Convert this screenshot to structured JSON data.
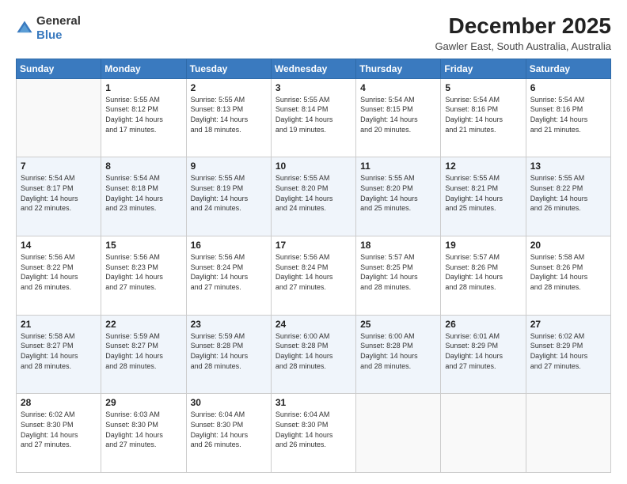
{
  "header": {
    "logo_general": "General",
    "logo_blue": "Blue",
    "title": "December 2025",
    "subtitle": "Gawler East, South Australia, Australia"
  },
  "calendar": {
    "days_of_week": [
      "Sunday",
      "Monday",
      "Tuesday",
      "Wednesday",
      "Thursday",
      "Friday",
      "Saturday"
    ],
    "weeks": [
      [
        {
          "day": "",
          "info": ""
        },
        {
          "day": "1",
          "info": "Sunrise: 5:55 AM\nSunset: 8:12 PM\nDaylight: 14 hours\nand 17 minutes."
        },
        {
          "day": "2",
          "info": "Sunrise: 5:55 AM\nSunset: 8:13 PM\nDaylight: 14 hours\nand 18 minutes."
        },
        {
          "day": "3",
          "info": "Sunrise: 5:55 AM\nSunset: 8:14 PM\nDaylight: 14 hours\nand 19 minutes."
        },
        {
          "day": "4",
          "info": "Sunrise: 5:54 AM\nSunset: 8:15 PM\nDaylight: 14 hours\nand 20 minutes."
        },
        {
          "day": "5",
          "info": "Sunrise: 5:54 AM\nSunset: 8:16 PM\nDaylight: 14 hours\nand 21 minutes."
        },
        {
          "day": "6",
          "info": "Sunrise: 5:54 AM\nSunset: 8:16 PM\nDaylight: 14 hours\nand 21 minutes."
        }
      ],
      [
        {
          "day": "7",
          "info": "Sunrise: 5:54 AM\nSunset: 8:17 PM\nDaylight: 14 hours\nand 22 minutes."
        },
        {
          "day": "8",
          "info": "Sunrise: 5:54 AM\nSunset: 8:18 PM\nDaylight: 14 hours\nand 23 minutes."
        },
        {
          "day": "9",
          "info": "Sunrise: 5:55 AM\nSunset: 8:19 PM\nDaylight: 14 hours\nand 24 minutes."
        },
        {
          "day": "10",
          "info": "Sunrise: 5:55 AM\nSunset: 8:20 PM\nDaylight: 14 hours\nand 24 minutes."
        },
        {
          "day": "11",
          "info": "Sunrise: 5:55 AM\nSunset: 8:20 PM\nDaylight: 14 hours\nand 25 minutes."
        },
        {
          "day": "12",
          "info": "Sunrise: 5:55 AM\nSunset: 8:21 PM\nDaylight: 14 hours\nand 25 minutes."
        },
        {
          "day": "13",
          "info": "Sunrise: 5:55 AM\nSunset: 8:22 PM\nDaylight: 14 hours\nand 26 minutes."
        }
      ],
      [
        {
          "day": "14",
          "info": "Sunrise: 5:56 AM\nSunset: 8:22 PM\nDaylight: 14 hours\nand 26 minutes."
        },
        {
          "day": "15",
          "info": "Sunrise: 5:56 AM\nSunset: 8:23 PM\nDaylight: 14 hours\nand 27 minutes."
        },
        {
          "day": "16",
          "info": "Sunrise: 5:56 AM\nSunset: 8:24 PM\nDaylight: 14 hours\nand 27 minutes."
        },
        {
          "day": "17",
          "info": "Sunrise: 5:56 AM\nSunset: 8:24 PM\nDaylight: 14 hours\nand 27 minutes."
        },
        {
          "day": "18",
          "info": "Sunrise: 5:57 AM\nSunset: 8:25 PM\nDaylight: 14 hours\nand 28 minutes."
        },
        {
          "day": "19",
          "info": "Sunrise: 5:57 AM\nSunset: 8:26 PM\nDaylight: 14 hours\nand 28 minutes."
        },
        {
          "day": "20",
          "info": "Sunrise: 5:58 AM\nSunset: 8:26 PM\nDaylight: 14 hours\nand 28 minutes."
        }
      ],
      [
        {
          "day": "21",
          "info": "Sunrise: 5:58 AM\nSunset: 8:27 PM\nDaylight: 14 hours\nand 28 minutes."
        },
        {
          "day": "22",
          "info": "Sunrise: 5:59 AM\nSunset: 8:27 PM\nDaylight: 14 hours\nand 28 minutes."
        },
        {
          "day": "23",
          "info": "Sunrise: 5:59 AM\nSunset: 8:28 PM\nDaylight: 14 hours\nand 28 minutes."
        },
        {
          "day": "24",
          "info": "Sunrise: 6:00 AM\nSunset: 8:28 PM\nDaylight: 14 hours\nand 28 minutes."
        },
        {
          "day": "25",
          "info": "Sunrise: 6:00 AM\nSunset: 8:28 PM\nDaylight: 14 hours\nand 28 minutes."
        },
        {
          "day": "26",
          "info": "Sunrise: 6:01 AM\nSunset: 8:29 PM\nDaylight: 14 hours\nand 27 minutes."
        },
        {
          "day": "27",
          "info": "Sunrise: 6:02 AM\nSunset: 8:29 PM\nDaylight: 14 hours\nand 27 minutes."
        }
      ],
      [
        {
          "day": "28",
          "info": "Sunrise: 6:02 AM\nSunset: 8:30 PM\nDaylight: 14 hours\nand 27 minutes."
        },
        {
          "day": "29",
          "info": "Sunrise: 6:03 AM\nSunset: 8:30 PM\nDaylight: 14 hours\nand 27 minutes."
        },
        {
          "day": "30",
          "info": "Sunrise: 6:04 AM\nSunset: 8:30 PM\nDaylight: 14 hours\nand 26 minutes."
        },
        {
          "day": "31",
          "info": "Sunrise: 6:04 AM\nSunset: 8:30 PM\nDaylight: 14 hours\nand 26 minutes."
        },
        {
          "day": "",
          "info": ""
        },
        {
          "day": "",
          "info": ""
        },
        {
          "day": "",
          "info": ""
        }
      ]
    ]
  }
}
